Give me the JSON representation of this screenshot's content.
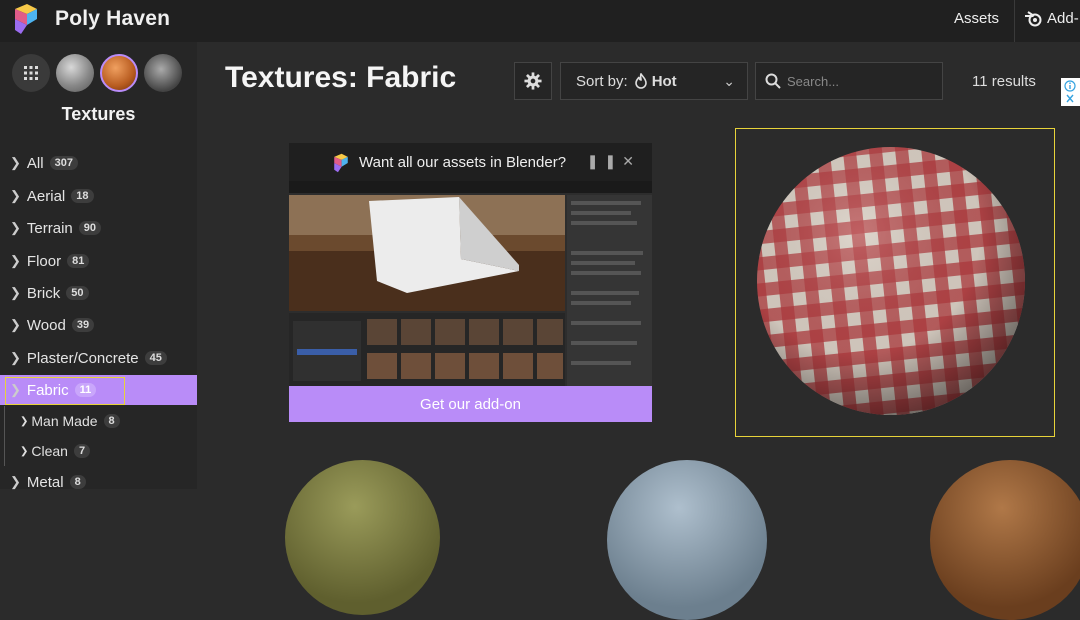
{
  "header": {
    "brand": "Poly Haven",
    "nav_assets": "Assets",
    "nav_addon": "Add-"
  },
  "sidebar": {
    "title": "Textures",
    "categories": [
      {
        "label": "All",
        "count": "307"
      },
      {
        "label": "Aerial",
        "count": "18"
      },
      {
        "label": "Terrain",
        "count": "90"
      },
      {
        "label": "Floor",
        "count": "81"
      },
      {
        "label": "Brick",
        "count": "50"
      },
      {
        "label": "Wood",
        "count": "39"
      },
      {
        "label": "Plaster/Concrete",
        "count": "45"
      },
      {
        "label": "Fabric",
        "count": "11"
      }
    ],
    "subcategories": [
      {
        "label": "Man Made",
        "count": "8"
      },
      {
        "label": "Clean",
        "count": "7"
      }
    ],
    "next_category": {
      "label": "Metal",
      "count": "8"
    }
  },
  "main": {
    "title": "Textures: Fabric",
    "sort_prefix": "Sort by:",
    "sort_value": "Hot",
    "search_placeholder": "Search...",
    "results": "11 results"
  },
  "promo": {
    "heading": "Want all our assets in Blender?",
    "button": "Get our add-on"
  },
  "colors": {
    "accent": "#b98cf8",
    "background": "#2b2b2b",
    "highlight": "#e8d33a"
  }
}
